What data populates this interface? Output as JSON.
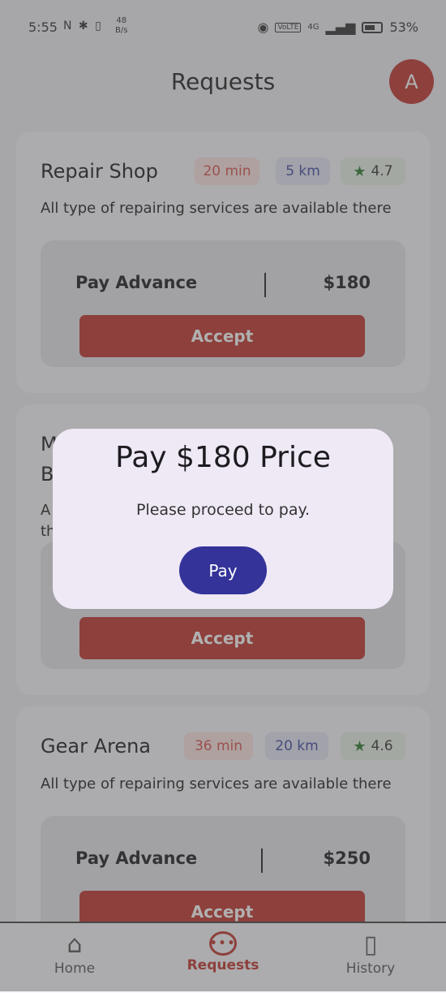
{
  "status_bar": {
    "time": "5:55",
    "left_icons": "N ✱ ▯",
    "speed_value": "48",
    "speed_unit": "B/s",
    "volte": "VoLTE",
    "network": "4G",
    "battery": "53%"
  },
  "header": {
    "title": "Requests",
    "avatar_initial": "A"
  },
  "requests": [
    {
      "name": "Repair Shop",
      "time": "20 min",
      "distance": "5 km",
      "rating": "4.7",
      "description": "All type of repairing services are available there",
      "pay_label": "Pay Advance",
      "amount": "$180",
      "accept_label": "Accept"
    },
    {
      "name": "M",
      "name_line2": "B",
      "description_start": "A",
      "description_line2": "th",
      "accept_label": "Accept"
    },
    {
      "name": "Gear Arena",
      "time": "36 min",
      "distance": "20 km",
      "rating": "4.6",
      "description": "All type of repairing services are available there",
      "pay_label": "Pay Advance",
      "amount": "$250",
      "accept_label": "Accept"
    }
  ],
  "dialog": {
    "title": "Pay $180 Price",
    "message": "Please proceed to pay.",
    "button_label": "Pay"
  },
  "bottom_nav": [
    {
      "label": "Home",
      "icon": "home-icon",
      "active": false
    },
    {
      "label": "Requests",
      "icon": "chat-bubble-icon",
      "active": true
    },
    {
      "label": "History",
      "icon": "book-icon",
      "active": false
    }
  ],
  "colors": {
    "accent": "#c0342c",
    "dialog_button": "#333399",
    "rating_star": "#2e7d32"
  }
}
